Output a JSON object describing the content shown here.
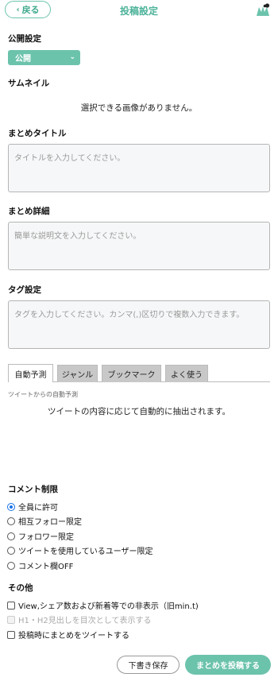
{
  "header": {
    "back_label": "戻る",
    "title": "投稿設定"
  },
  "visibility": {
    "label": "公開設定",
    "selected": "公開"
  },
  "thumbnail": {
    "label": "サムネイル",
    "message": "選択できる画像がありません。"
  },
  "title_field": {
    "label": "まとめタイトル",
    "placeholder": "タイトルを入力してください。"
  },
  "detail_field": {
    "label": "まとめ詳細",
    "placeholder": "簡単な説明文を入力してください。"
  },
  "tag_field": {
    "label": "タグ設定",
    "placeholder": "タグを入力してください。カンマ(,)区切りで複数入力できます。"
  },
  "tabs": [
    {
      "label": "自動予測",
      "active": true
    },
    {
      "label": "ジャンル",
      "active": false
    },
    {
      "label": "ブックマーク",
      "active": false
    },
    {
      "label": "よく使う",
      "active": false
    }
  ],
  "auto_predict": {
    "caption": "ツイートからの自動予測",
    "message": "ツイートの内容に応じて自動的に抽出されます。"
  },
  "comment_limit": {
    "label": "コメント制限",
    "options": [
      {
        "label": "全員に許可",
        "checked": true
      },
      {
        "label": "相互フォロー限定",
        "checked": false
      },
      {
        "label": "フォロワー限定",
        "checked": false
      },
      {
        "label": "ツイートを使用しているユーザー限定",
        "checked": false
      },
      {
        "label": "コメント欄OFF",
        "checked": false
      }
    ]
  },
  "other": {
    "label": "その他",
    "options": [
      {
        "label": "View,シェア数および新着等での非表示（旧min.t)",
        "checked": false,
        "disabled": false
      },
      {
        "label": "H1・H2見出しを目次として表示する",
        "checked": false,
        "disabled": true
      },
      {
        "label": "投稿時にまとめをツイートする",
        "checked": false,
        "disabled": false
      }
    ]
  },
  "actions": {
    "draft_label": "下書き保存",
    "post_label": "まとめを投稿する"
  },
  "colors": {
    "accent": "#6cc3ac",
    "accent_text": "#4db39a",
    "radio_checked": "#1a73e8"
  }
}
